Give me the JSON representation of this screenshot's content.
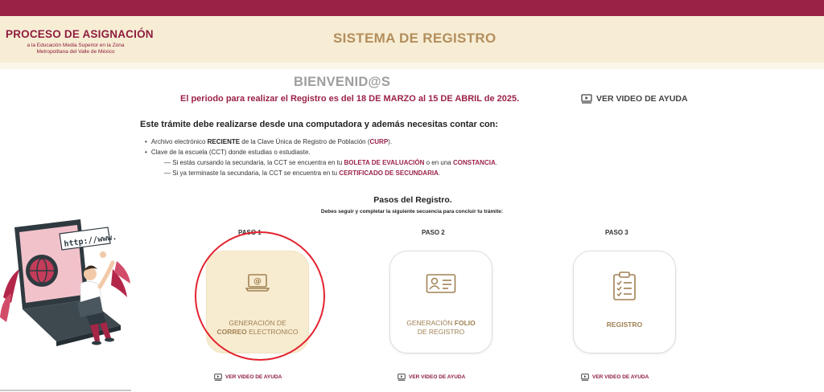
{
  "header": {
    "logo_title": "PROCESO DE ASIGNACIÓN",
    "logo_sub_1": "a la Educación Media Superior en la Zona",
    "logo_sub_2": "Metropolitana del Valle de México",
    "system_title": "SISTEMA DE REGISTRO"
  },
  "main": {
    "welcome": "BIENVENID@S",
    "period": "El periodo para realizar el Registro es del 18 DE MARZO al 15 DE ABRIL de 2025.",
    "help_video": "VER VIDEO DE AYUDA",
    "notice": "Este trámite debe realizarse desde una computadora y además necesitas contar con:",
    "requirements": {
      "r1_a": "Archivo electrónico ",
      "r1_b": "RECIENTE",
      "r1_c": " de la Clave Única de Registro de Población (",
      "r1_d": "CURP",
      "r1_e": ").",
      "r2": "Clave de la escuela (CCT) donde estudias o estudiaste.",
      "r3_a": "— Si estás cursando la secundaria, la CCT se encuentra en tu ",
      "r3_b": "BOLETA DE EVALUACIÓN",
      "r3_c": " o en una ",
      "r3_d": "CONSTANCIA",
      "r3_e": ".",
      "r4_a": "— Si ya terminaste la secundaria, la CCT se encuentra en tu ",
      "r4_b": "CERTIFICADO DE SECUNDARIA",
      "r4_c": "."
    },
    "steps_title": "Pasos del Registro.",
    "steps_sub": "Debes seguir y completar la siguiente secuencia para concluir tu trámite:",
    "steps": [
      {
        "paso": "PASO 1",
        "line1": "GENERACIÓN DE",
        "line2_bold": "CORREO",
        "line2_rest": " ELECTRONICO",
        "icon": "laptop-email-icon",
        "help": "VER VIDEO DE AYUDA"
      },
      {
        "paso": "PASO 2",
        "line1_a": "GENERACIÓN ",
        "line1_bold": "FOLIO",
        "line2": "DE REGISTRO",
        "icon": "id-card-icon",
        "help": "VER VIDEO DE AYUDA"
      },
      {
        "paso": "PASO 3",
        "line1": "REGISTRO",
        "icon": "clipboard-checklist-icon",
        "help": "VER VIDEO DE AYUDA"
      }
    ],
    "illustration_text": "http://www."
  },
  "colors": {
    "brand": "#9b2247",
    "gold": "#b38e5d",
    "cream": "#f7edd4",
    "highlight_circle": "#e3222e"
  }
}
